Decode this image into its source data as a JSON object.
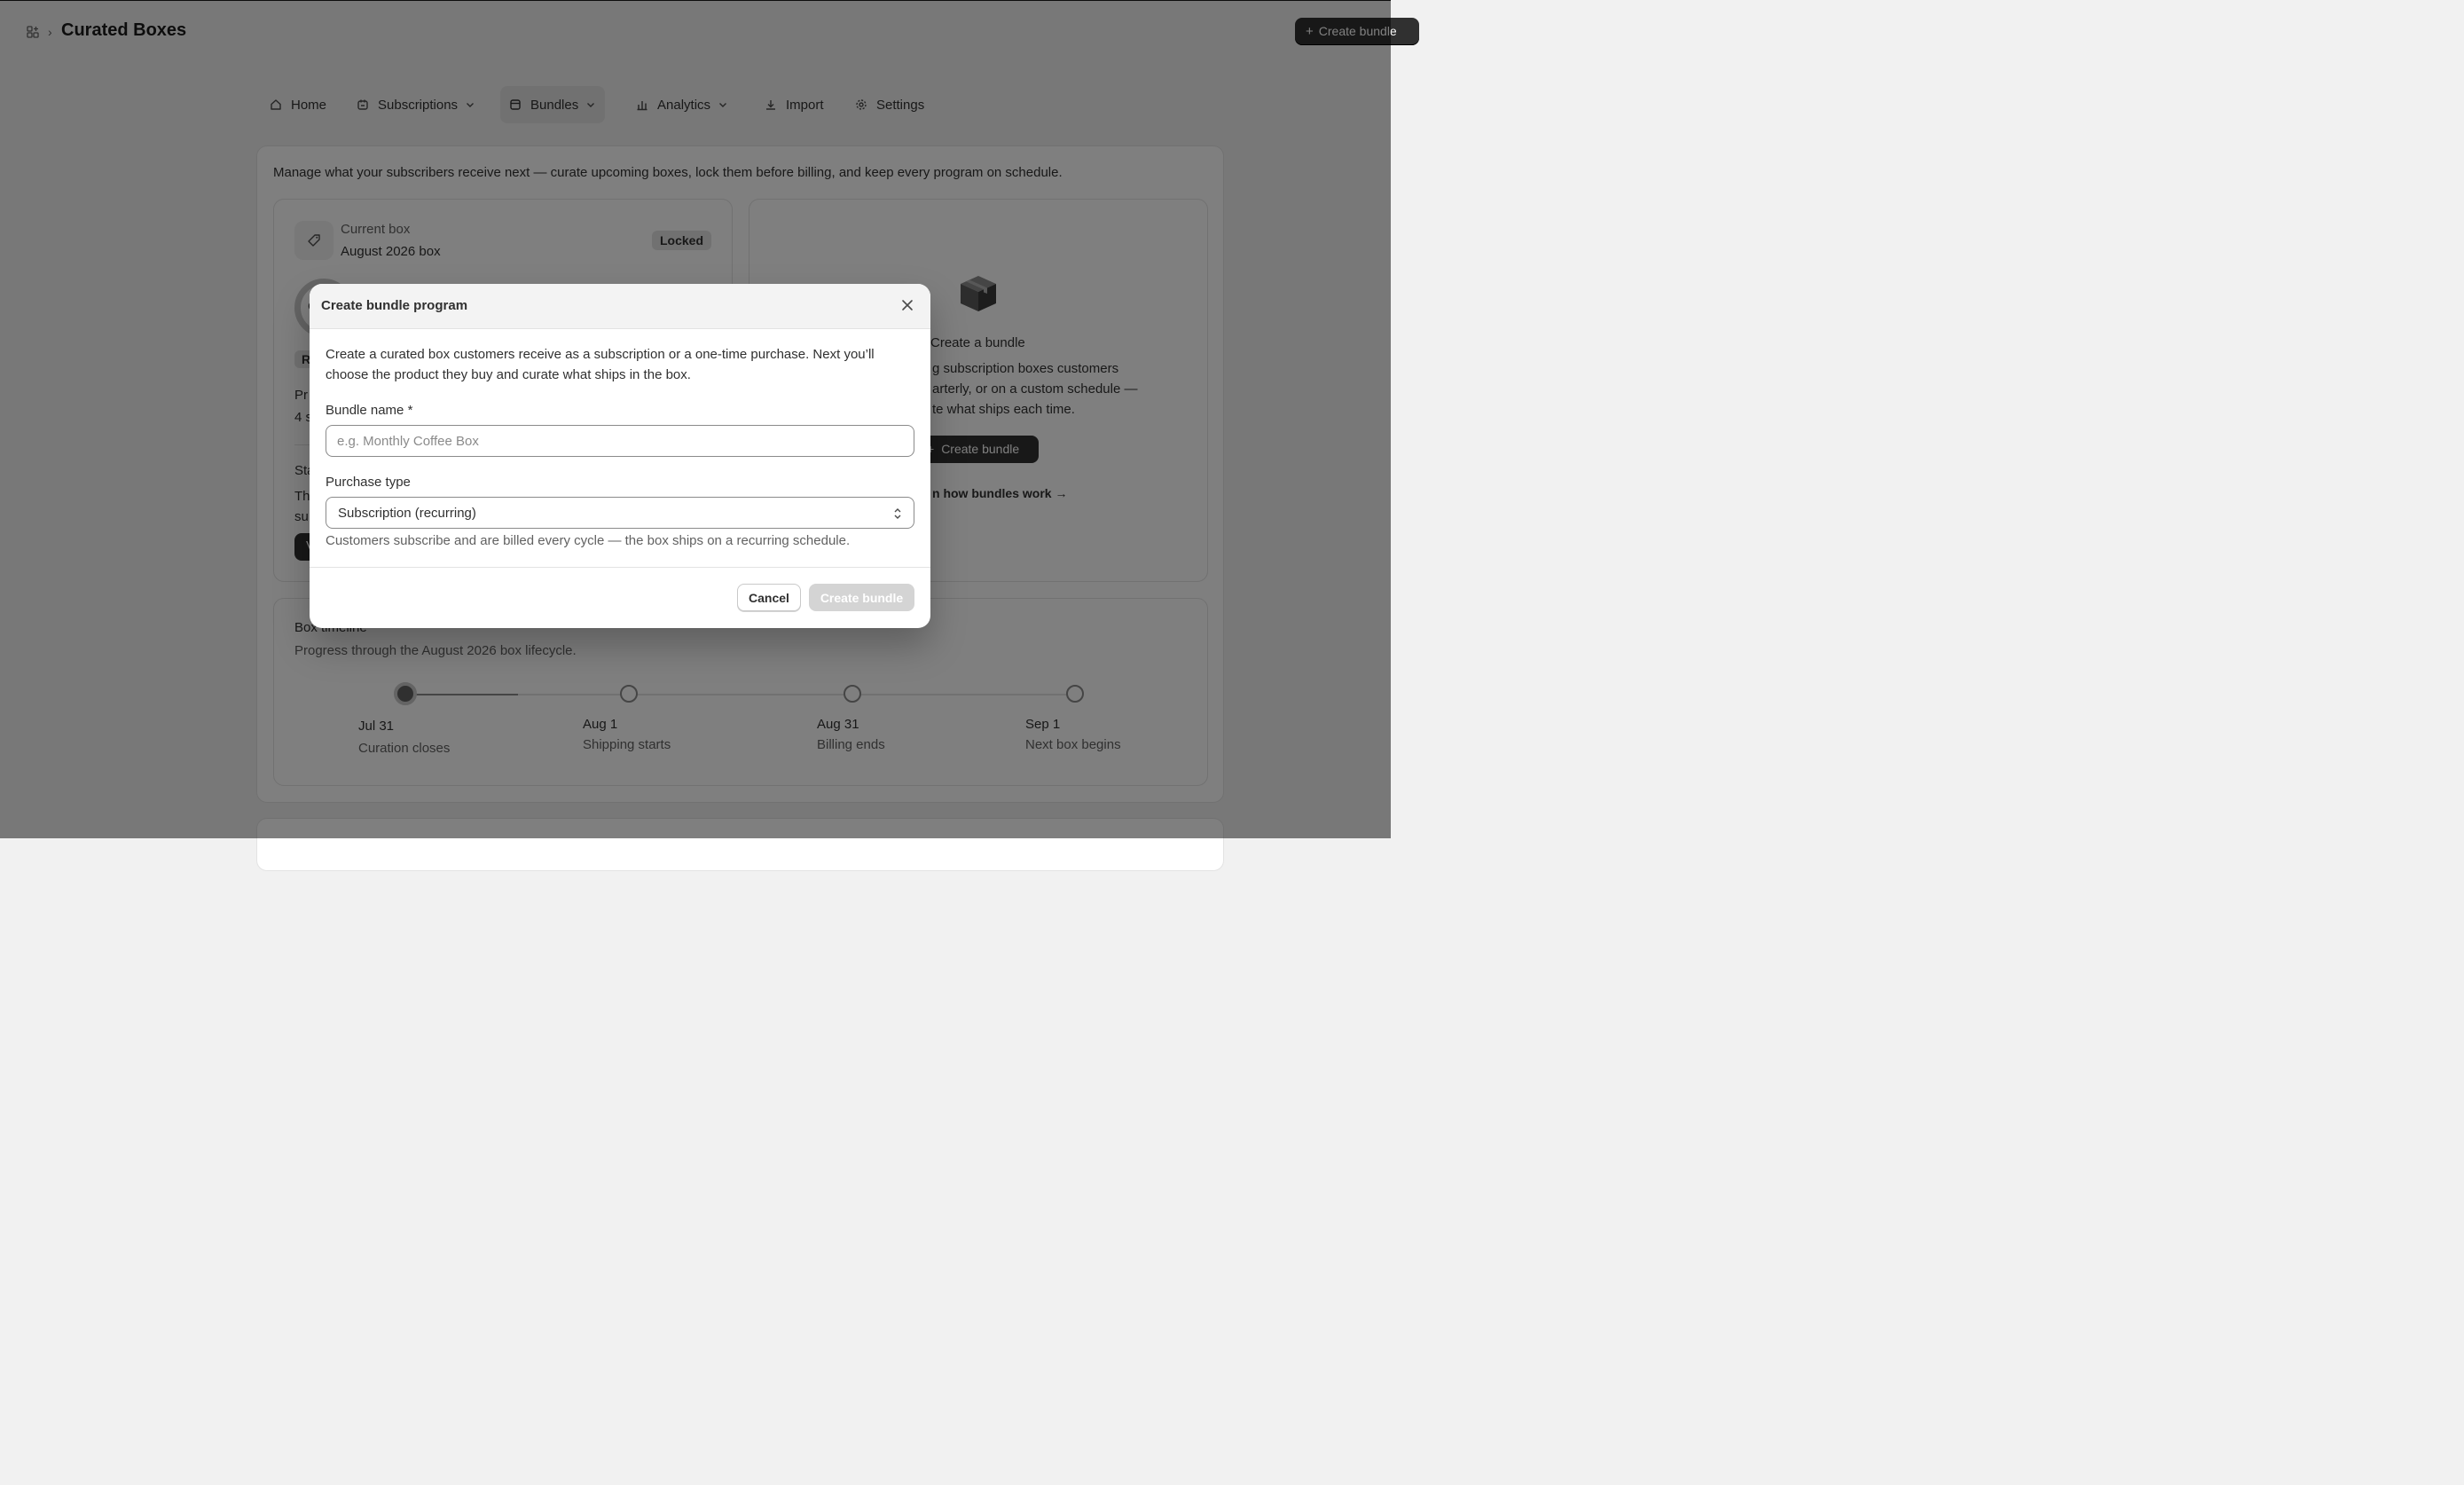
{
  "header": {
    "title": "Curated Boxes",
    "breadcrumb_separator": "›",
    "create_button": "Create bundle"
  },
  "nav": {
    "items": [
      {
        "label": "Home",
        "icon": "home-icon"
      },
      {
        "label": "Subscriptions",
        "icon": "subscriptions-icon",
        "dropdown": true
      },
      {
        "label": "Bundles",
        "icon": "bundles-icon",
        "dropdown": true,
        "active": true
      },
      {
        "label": "Analytics",
        "icon": "analytics-icon",
        "dropdown": true
      },
      {
        "label": "Import",
        "icon": "import-icon"
      },
      {
        "label": "Settings",
        "icon": "gear-icon"
      }
    ]
  },
  "page": {
    "description": "Manage what your subscribers receive next — curate upcoming boxes, lock them before billing, and keep every program on schedule."
  },
  "current_box": {
    "label": "Current box",
    "value": "August 2026 box",
    "status": "Locked",
    "partial_text": [
      "R",
      "Pr",
      "4 s",
      "Sta",
      "Th",
      "su",
      "V",
      "C"
    ]
  },
  "empty_state": {
    "title": "Create a bundle",
    "lines": [
      "g subscription boxes customers",
      "arterly, or on a custom schedule —",
      "te what ships each time."
    ],
    "button": "Create bundle",
    "link": "n how bundles work →"
  },
  "timeline": {
    "title": "Box timeline",
    "subtitle": "Progress through the August 2026 box lifecycle.",
    "steps": [
      {
        "date": "Jul 31",
        "label": "Curation closes",
        "done": true
      },
      {
        "date": "Aug 1",
        "label": "Shipping starts",
        "done": false
      },
      {
        "date": "Aug 31",
        "label": "Billing ends",
        "done": false
      },
      {
        "date": "Sep 1",
        "label": "Next box begins",
        "done": false
      }
    ]
  },
  "modal": {
    "title": "Create bundle program",
    "intro": "Create a curated box customers receive as a subscription or a one-time purchase. Next you’ll choose the product they buy and curate what ships in the box.",
    "name_label": "Bundle name *",
    "name_placeholder": "e.g. Monthly Coffee Box",
    "name_value": "",
    "purchase_label": "Purchase type",
    "purchase_value": "Subscription (recurring)",
    "purchase_help": "Customers subscribe and are billed every cycle — the box ships on a recurring schedule.",
    "cancel": "Cancel",
    "create": "Create bundle",
    "create_disabled": true
  },
  "colors": {
    "accent_dark": "#303030",
    "overlay": "rgba(0,0,0,0.5)",
    "disabled_button": "#d4d4d4"
  }
}
